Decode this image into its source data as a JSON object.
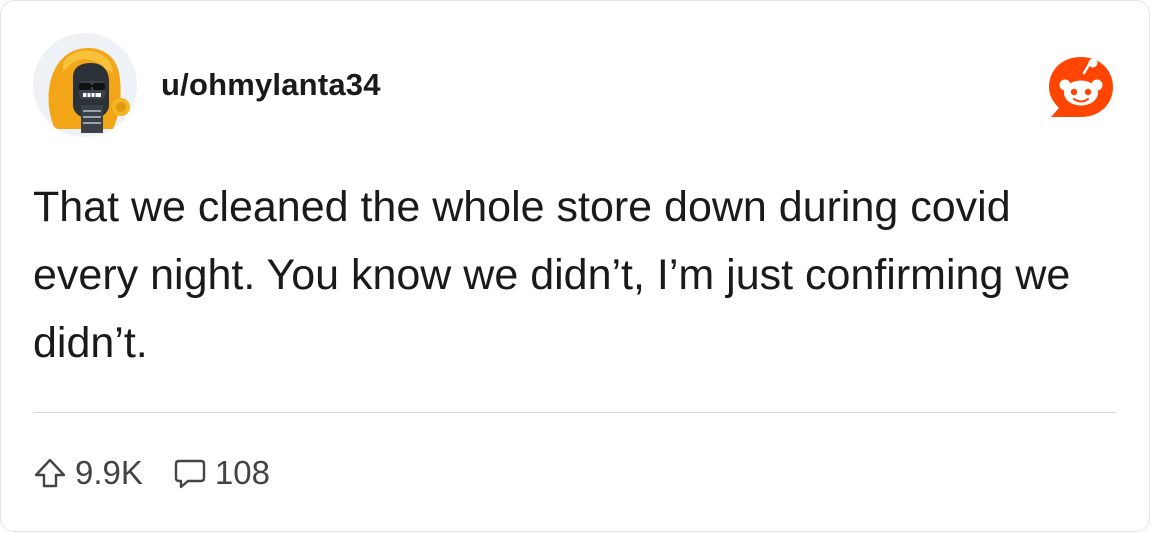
{
  "post": {
    "username": "u/ohmylanta34",
    "body": "That we cleaned the whole store down during covid every night. You know we didn’t, I’m just confirming we didn’t.",
    "upvotes": "9.9K",
    "comments": "108"
  },
  "icons": {
    "avatar": "user-avatar",
    "logo": "reddit-logo-icon",
    "upvote": "upvote-arrow-icon",
    "comment": "comment-bubble-icon"
  },
  "colors": {
    "reddit_orange": "#ff4500",
    "text": "#1a1a1b",
    "meta": "#576f76",
    "divider": "#dcdcdc"
  }
}
